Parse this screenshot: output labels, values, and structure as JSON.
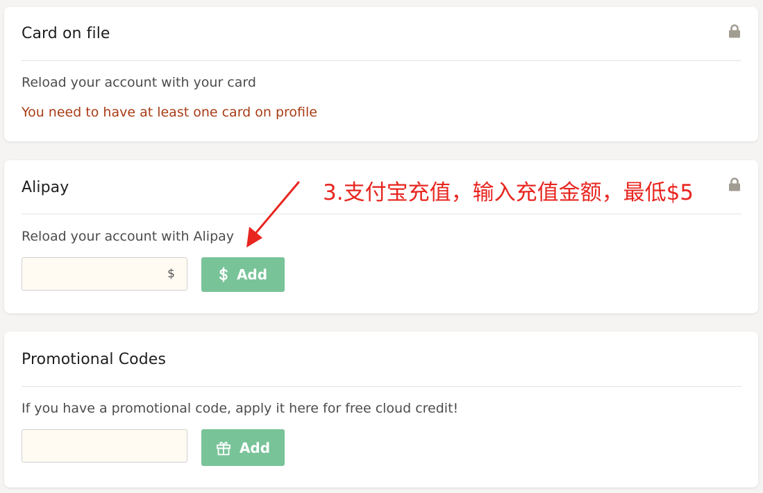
{
  "colors": {
    "accent_green": "#79c399",
    "warning_text": "#a83c16",
    "annotation_red": "#e8251f",
    "lock_gray": "#a19c92",
    "input_bg": "#fffbf3"
  },
  "card_on_file": {
    "title": "Card on file",
    "description": "Reload your account with your card",
    "warning": "You need to have at least one card on profile",
    "icon": "lock-icon"
  },
  "alipay": {
    "title": "Alipay",
    "description": "Reload your account with Alipay",
    "amount_value": "",
    "currency_suffix": "$",
    "add_button_label": "Add",
    "button_icon": "dollar-icon",
    "icon": "lock-icon"
  },
  "annotation": {
    "text": "3.支付宝充值，输入充值金额，最低$5"
  },
  "promotional": {
    "title": "Promotional Codes",
    "description": "If you have a promotional code, apply it here for free cloud credit!",
    "code_value": "",
    "add_button_label": "Add",
    "button_icon": "gift-icon"
  }
}
